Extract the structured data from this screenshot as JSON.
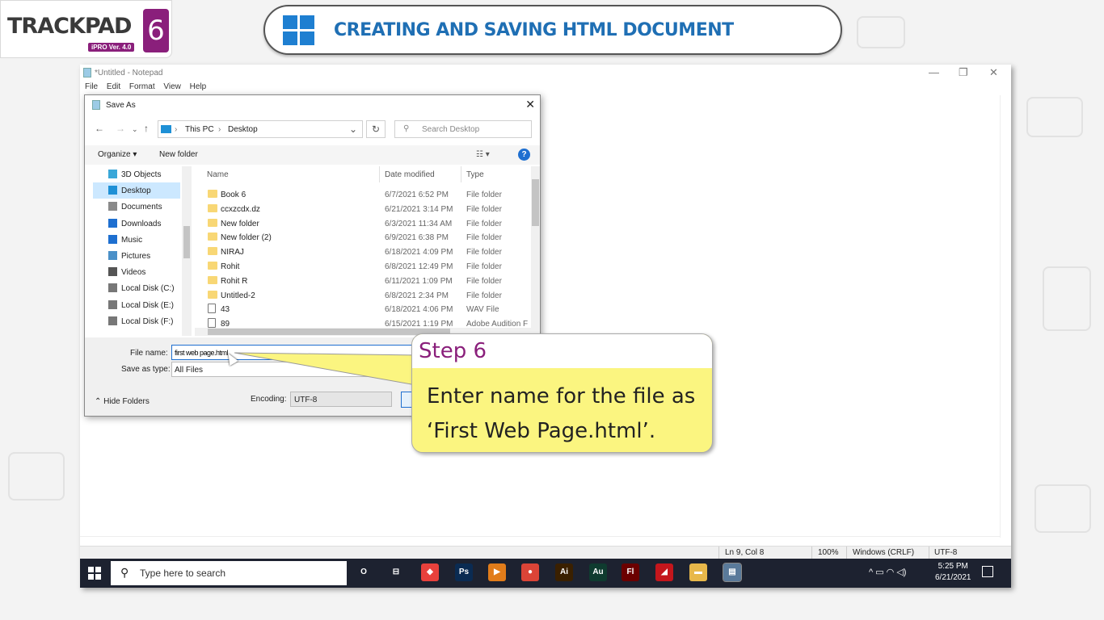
{
  "logo": {
    "brand": "TRACKPAD",
    "number": "6",
    "version": "iPRO Ver. 4.0"
  },
  "banner": {
    "title": "CREATING AND SAVING HTML DOCUMENT"
  },
  "notepad": {
    "title": "*Untitled - Notepad",
    "menu": [
      "File",
      "Edit",
      "Format",
      "View",
      "Help"
    ],
    "status": {
      "position": "Ln 9, Col 8",
      "zoom": "100%",
      "line_ending": "Windows (CRLF)",
      "encoding": "UTF-8"
    }
  },
  "dialog": {
    "title": "Save As",
    "breadcrumb": [
      "This PC",
      "Desktop"
    ],
    "search_placeholder": "Search Desktop",
    "toolbar": {
      "organize": "Organize",
      "new_folder": "New folder"
    },
    "tree": [
      "3D Objects",
      "Desktop",
      "Documents",
      "Downloads",
      "Music",
      "Pictures",
      "Videos",
      "Local Disk (C:)",
      "Local Disk (E:)",
      "Local Disk (F:)"
    ],
    "tree_selected": "Desktop",
    "columns": {
      "name": "Name",
      "date": "Date modified",
      "type": "Type"
    },
    "files": [
      {
        "name": "Book 6",
        "date": "6/7/2021 6:52 PM",
        "type": "File folder",
        "kind": "folder"
      },
      {
        "name": "ccxzcdx.dz",
        "date": "6/21/2021 3:14 PM",
        "type": "File folder",
        "kind": "folder"
      },
      {
        "name": "New folder",
        "date": "6/3/2021 11:34 AM",
        "type": "File folder",
        "kind": "folder"
      },
      {
        "name": "New folder (2)",
        "date": "6/9/2021 6:38 PM",
        "type": "File folder",
        "kind": "folder"
      },
      {
        "name": "NIRAJ",
        "date": "6/18/2021 4:09 PM",
        "type": "File folder",
        "kind": "folder"
      },
      {
        "name": "Rohit",
        "date": "6/8/2021 12:49 PM",
        "type": "File folder",
        "kind": "folder"
      },
      {
        "name": "Rohit R",
        "date": "6/11/2021 1:09 PM",
        "type": "File folder",
        "kind": "folder"
      },
      {
        "name": "Untitled-2",
        "date": "6/8/2021 2:34 PM",
        "type": "File folder",
        "kind": "folder"
      },
      {
        "name": "43",
        "date": "6/18/2021 4:06 PM",
        "type": "WAV File",
        "kind": "file"
      },
      {
        "name": "89",
        "date": "6/15/2021 1:19 PM",
        "type": "Adobe Audition F",
        "kind": "file"
      }
    ],
    "file_name_label": "File name:",
    "file_name_value": "first web page.html",
    "save_type_label": "Save as type:",
    "save_type_value": "All Files",
    "hide_folders": "Hide Folders",
    "encoding_label": "Encoding:",
    "encoding_value": "UTF-8"
  },
  "taskbar": {
    "search_placeholder": "Type here to search",
    "apps": [
      {
        "name": "cortana",
        "label": "O",
        "color": "#1d2230"
      },
      {
        "name": "task-view",
        "label": "⊟",
        "color": "#1d2230"
      },
      {
        "name": "anydesk",
        "label": "◆",
        "color": "#e8413c"
      },
      {
        "name": "photoshop",
        "label": "Ps",
        "color": "#0a2b52"
      },
      {
        "name": "media-player",
        "label": "▶",
        "color": "#e17c1a"
      },
      {
        "name": "chrome",
        "label": "●",
        "color": "#db4437"
      },
      {
        "name": "illustrator",
        "label": "Ai",
        "color": "#3a2000"
      },
      {
        "name": "audition",
        "label": "Au",
        "color": "#0f3b2f"
      },
      {
        "name": "flash",
        "label": "Fl",
        "color": "#6b0000"
      },
      {
        "name": "acrobat",
        "label": "◢",
        "color": "#c4161c"
      },
      {
        "name": "file-explorer",
        "label": "▬",
        "color": "#e8b84a"
      },
      {
        "name": "notepad",
        "label": "▤",
        "color": "#5a7a9a"
      }
    ],
    "tray": "^ ▭ ◠ ◁)",
    "time": "5:25 PM",
    "date": "6/21/2021"
  },
  "callout": {
    "step": "Step 6",
    "text": "Enter name for the file as ‘First Web Page.html’."
  },
  "colors": {
    "accent": "#8a1f7b",
    "banner_text": "#1f6fb4",
    "callout_bg": "#fbf580"
  }
}
